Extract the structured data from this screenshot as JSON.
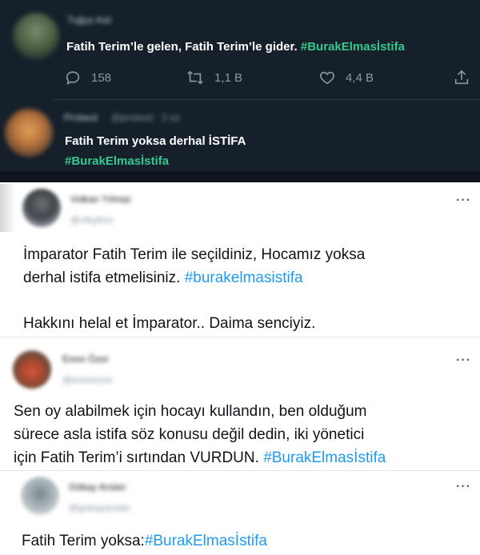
{
  "tweets": [
    {
      "theme": "dark",
      "author_name": "Tuğçe Aslı",
      "text": "Fatih Terim’le gelen, Fatih Terim’le gider.",
      "hashtag": "#BurakElmasİstifa",
      "replies": "158",
      "retweets": "1,1 B",
      "likes": "4,4 B"
    },
    {
      "theme": "dark",
      "author_name": "Prolaud",
      "author_meta": "@prolaud · 3 sa",
      "text": "Fatih Terim yoksa derhal İSTİFA",
      "hashtag": "#BurakElmasİstifa"
    },
    {
      "theme": "light",
      "author_name": "Volkan Yılmaz",
      "author_handle": "@vlkyilmz",
      "line1": "İmparator Fatih Terim ile seçildiniz,  Hocamız yoksa",
      "line2_text": "derhal istifa etmelisiniz. ",
      "hashtag": "#burakelmasistifa",
      "line3": "Hakkını helal et İmparator.. Daima senciyiz."
    },
    {
      "theme": "light",
      "author_name": "Emre Özer",
      "author_handle": "@emreozer",
      "line1": "Sen oy alabilmek için hocayı kullandın, ben olduğum",
      "line2": "sürece asla istifa söz konusu değil dedin, iki yönetici",
      "line3_text": "için Fatih Terim’i sırtından VURDUN. ",
      "hashtag": "#BurakElmasİstifa"
    },
    {
      "theme": "light",
      "author_name": "Gökay Arslan",
      "author_handle": "@gokayarslan",
      "text": "Fatih Terim yoksa:",
      "hashtag": "#BurakElmasİstifa"
    }
  ],
  "icons": {
    "more": "more-dots-icon",
    "reply": "reply-icon",
    "retweet": "retweet-icon",
    "like": "like-icon",
    "share": "share-icon"
  },
  "colors": {
    "dark_bg": "#15202b",
    "dark_hashtag": "#36c78e",
    "light_hashtag": "#1d9bf0",
    "muted": "#8899a6"
  }
}
